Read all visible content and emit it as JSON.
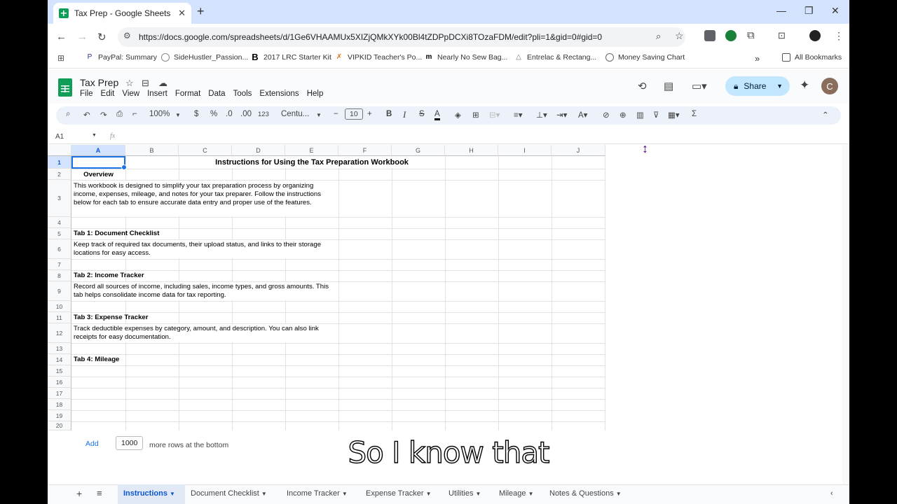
{
  "browser": {
    "tab_title": "Tax Prep - Google Sheets",
    "new_tab_symbol": "+",
    "url": "https://docs.google.com/spreadsheets/d/1Ge6VHAAMUx5XIZjQMkXYk00Bl4tZDPpDCXi8TOzaFDM/edit?pli=1&gid=0#gid=0",
    "bookmarks": [
      "PayPal: Summary",
      "SideHustler_Passion...",
      "2017 LRC Starter Kit",
      "VIPKID Teacher's Po...",
      "Nearly No Sew Bag...",
      "Entrelac & Rectang...",
      "Money Saving Chart"
    ],
    "all_bookmarks": "All Bookmarks",
    "more_bookmarks": "»"
  },
  "sheets": {
    "doc_title": "Tax Prep",
    "menu": [
      "File",
      "Edit",
      "View",
      "Insert",
      "Format",
      "Data",
      "Tools",
      "Extensions",
      "Help"
    ],
    "share_label": "Share",
    "avatar_letter": "C",
    "toolbar": {
      "zoom": "100%",
      "currency": "$",
      "percent": "%",
      "dec_decrease": ".0",
      "dec_increase": ".00",
      "number_format": "123",
      "font": "Centu...",
      "font_size": "10",
      "bold": "B",
      "italic": "I",
      "strike": "S",
      "text_color": "A",
      "sum": "Σ"
    },
    "name_box": "A1",
    "fx": "fx"
  },
  "grid": {
    "columns": [
      "A",
      "B",
      "C",
      "D",
      "E",
      "F",
      "G",
      "H",
      "I",
      "J"
    ],
    "rows": [
      "1",
      "2",
      "3",
      "4",
      "5",
      "6",
      "7",
      "8",
      "9",
      "10",
      "11",
      "12",
      "13",
      "14",
      "15",
      "16",
      "17",
      "18",
      "19",
      "20"
    ],
    "cells": {
      "title": "Instructions for Using the Tax Preparation Workbook",
      "overview": "Overview",
      "overview_text": "This workbook is designed to simplify your tax preparation process by organizing income, expenses, mileage, and notes for your tax preparer. Follow the instructions below for each tab to ensure accurate data entry and proper use of the features.",
      "tab1_title": "Tab 1: Document Checklist",
      "tab1_text": "Keep track of required tax documents, their upload status, and links to their storage locations for easy access.",
      "tab2_title": "Tab 2: Income Tracker",
      "tab2_text": "Record all sources of income, including sales, income types, and gross amounts. This tab helps consolidate income data for tax reporting.",
      "tab3_title": "Tab 3: Expense Tracker",
      "tab3_text": "Track deductible expenses by category, amount, and description. You can also link receipts for easy documentation.",
      "tab4_title": "Tab 4: Mileage"
    }
  },
  "add_rows": {
    "button": "Add",
    "count": "1000",
    "suffix": "more rows at the bottom"
  },
  "caption": "So I know that",
  "sheet_tabs": {
    "add_symbol": "+",
    "tabs": [
      "Instructions",
      "Document Checklist",
      "Income Tracker",
      "Expense Tracker",
      "Utilities",
      "Mileage",
      "Notes & Questions"
    ]
  }
}
